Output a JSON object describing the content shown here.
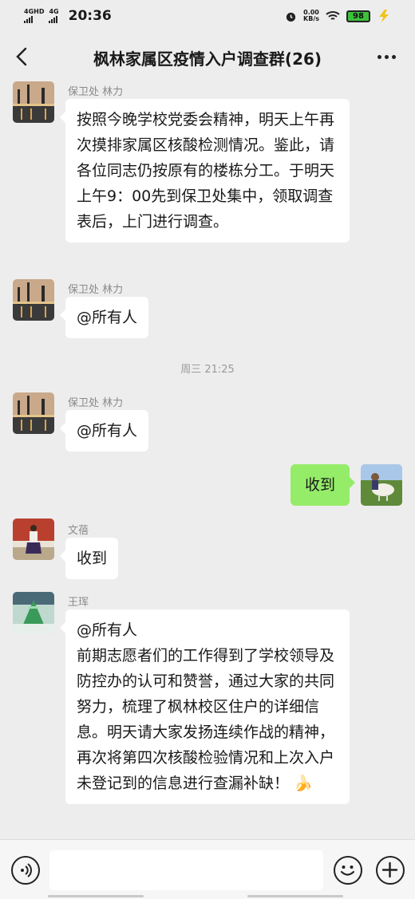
{
  "status_bar": {
    "network_1": "4GHD",
    "network_2": "4G",
    "time": "20:36",
    "speed_value": "0.00",
    "speed_unit": "KB/s",
    "battery": "98"
  },
  "header": {
    "title": "枫林家属区疫情入户调查群(26)"
  },
  "messages": [
    {
      "sender": "保卫处 林力",
      "text": "按照今晚学校党委会精神，明天上午再次摸排家属区核酸检测情况。鉴此，请各位同志仍按原有的楼栋分工。于明天上午9：00先到保卫处集中，领取调查表后，上门进行调查。",
      "avatar": "city-skyline-avatar"
    },
    {
      "sender": "保卫处 林力",
      "text": "@所有人",
      "avatar": "city-skyline-avatar"
    },
    {
      "time_divider": "周三 21:25"
    },
    {
      "sender": "保卫处 林力",
      "text": "@所有人",
      "avatar": "city-skyline-avatar"
    },
    {
      "sender": "",
      "text": "收到",
      "avatar": "sheep-avatar",
      "self": true
    },
    {
      "sender": "文蓓",
      "text": "收到",
      "avatar": "person-standing-avatar"
    },
    {
      "sender": "王珲",
      "text_line1": "@所有人",
      "text": "前期志愿者们的工作得到了学校领导及防控办的认可和赞誉，通过大家的共同努力，梳理了枫林校区住户的详细信息。明天请大家发扬连续作战的精神，再次将第四次核酸检验情况和上次入户未登记到的信息进行查漏补缺！",
      "emoji": "🍌",
      "avatar": "green-glass-avatar"
    }
  ],
  "input": {
    "placeholder": ""
  },
  "icons": {
    "voice": "voice-icon",
    "emoji": "emoji-icon",
    "plus": "plus-icon",
    "back": "back-arrow-icon",
    "more": "more-icon"
  },
  "colors": {
    "self_bubble": "#95ec69",
    "other_bubble": "#ffffff",
    "background": "#ededed"
  }
}
